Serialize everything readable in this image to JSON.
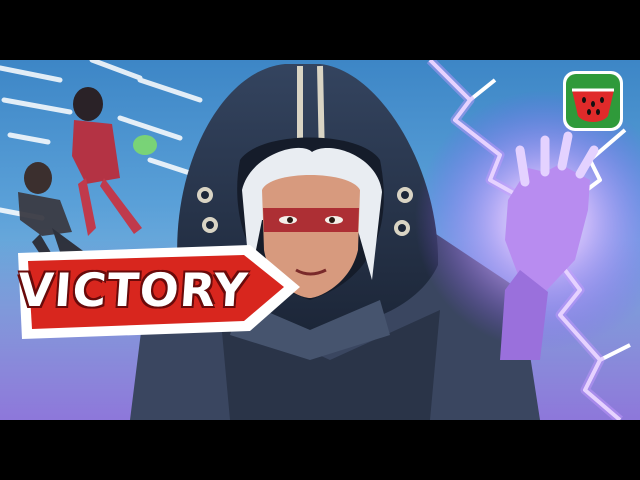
{
  "thumbnail": {
    "banner_text": "VICTORY",
    "colors": {
      "sky": "#5aa0d8",
      "banner_red": "#d8261e",
      "lightning": "#c79bff",
      "hood": "#2a3850",
      "logo_green": "#2f9a3a",
      "logo_red": "#e02a2a"
    },
    "icons": [
      "watermelon-logo-icon",
      "lightning-bolt-icon"
    ]
  }
}
